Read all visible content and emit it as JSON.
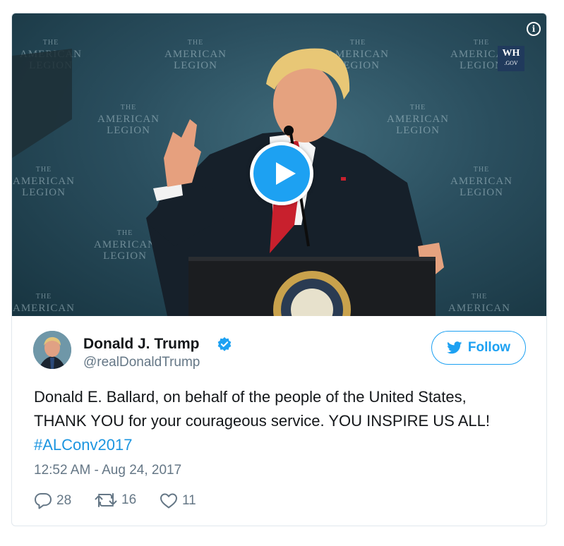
{
  "media": {
    "watermark_line1": "THE",
    "watermark_line2": "AMERICAN",
    "watermark_line3": "LEGION",
    "logo_main": "WH",
    "logo_sub": ".GOV",
    "info_icon": "i",
    "play_icon": "play-icon"
  },
  "author": {
    "name": "Donald J. Trump",
    "handle": "@realDonaldTrump",
    "verified": true
  },
  "follow": {
    "label": "Follow",
    "icon": "twitter-bird-icon"
  },
  "tweet": {
    "line1": "Donald E. Ballard, on behalf of the people of the United States,",
    "line2": "THANK YOU for your courageous service. YOU INSPIRE US ALL!",
    "hashtag": "#ALConv2017"
  },
  "timestamp": "12:52 AM - Aug 24, 2017",
  "actions": {
    "replies": "28",
    "retweets": "16",
    "likes": "11"
  },
  "colors": {
    "accent": "#1da1f2",
    "hashtag": "#1b95e0",
    "secondary_text": "#657786",
    "primary_text": "#14171a"
  }
}
